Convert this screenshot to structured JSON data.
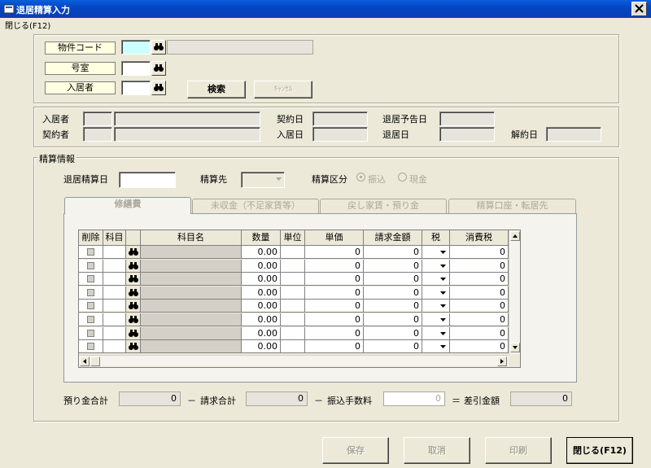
{
  "window": {
    "title": "退居精算入力"
  },
  "menu": {
    "close_label": "閉じる(F12)"
  },
  "search": {
    "property_code_label": "物件コード",
    "room_label": "号室",
    "tenant_label": "入居者",
    "search_button": "検索",
    "cancel_button": "ｷｬﾝｾﾙ"
  },
  "info": {
    "tenant_label": "入居者",
    "contractor_label": "契約者",
    "contract_date_label": "契約日",
    "move_in_date_label": "入居日",
    "move_out_planned_label": "退居予告日",
    "move_out_date_label": "退居日",
    "cancellation_date_label": "解約日"
  },
  "settlement": {
    "group_label": "精算情報",
    "move_out_date_label": "退居精算日",
    "target_label": "精算先",
    "type_label": "精算区分",
    "radio_transfer": "振込",
    "radio_cash": "現金"
  },
  "tabs": [
    {
      "label": "修繕費"
    },
    {
      "label": "未収金（不足家賃等）"
    },
    {
      "label": "戻し家賃・預り金"
    },
    {
      "label": "精算口座・転居先"
    }
  ],
  "grid": {
    "headers": [
      "削除",
      "科目",
      "",
      "科目名",
      "数量",
      "単位",
      "単価",
      "請求金額",
      "税",
      "消費税"
    ],
    "rows": [
      {
        "qty": "0.00",
        "price": "0",
        "amount": "0",
        "tax": "0"
      },
      {
        "qty": "0.00",
        "price": "0",
        "amount": "0",
        "tax": "0"
      },
      {
        "qty": "0.00",
        "price": "0",
        "amount": "0",
        "tax": "0"
      },
      {
        "qty": "0.00",
        "price": "0",
        "amount": "0",
        "tax": "0"
      },
      {
        "qty": "0.00",
        "price": "0",
        "amount": "0",
        "tax": "0"
      },
      {
        "qty": "0.00",
        "price": "0",
        "amount": "0",
        "tax": "0"
      },
      {
        "qty": "0.00",
        "price": "0",
        "amount": "0",
        "tax": "0"
      },
      {
        "qty": "0.00",
        "price": "0",
        "amount": "0",
        "tax": "0"
      }
    ]
  },
  "totals": {
    "deposit_label": "預り金合計",
    "deposit_value": "0",
    "minus1": "－",
    "billing_label": "請求合計",
    "billing_value": "0",
    "minus2": "－",
    "fee_label": "振込手数料",
    "fee_value": "0",
    "equals": "＝",
    "net_label": "差引金額",
    "net_value": "0"
  },
  "buttons": {
    "save": "保存",
    "cancel": "取消",
    "print": "印刷",
    "close": "閉じる(F12)"
  },
  "colors": {
    "title_bar": "#0a5fdc",
    "key_field": "#ccffff",
    "key_label": "#ffffe1"
  }
}
